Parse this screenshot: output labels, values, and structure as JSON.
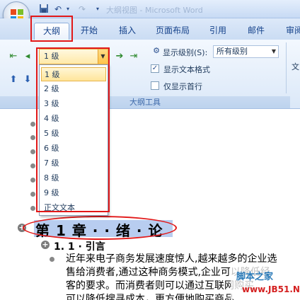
{
  "titlebar": {
    "title": "大纲视图 - Microsoft Word"
  },
  "quick_access": {
    "save_icon": "save-icon",
    "undo_icon": "undo-icon",
    "redo_icon": "redo-icon"
  },
  "tabs": [
    {
      "label": "大纲",
      "active": true
    },
    {
      "label": "开始"
    },
    {
      "label": "插入"
    },
    {
      "label": "页面布局"
    },
    {
      "label": "引用"
    },
    {
      "label": "邮件"
    },
    {
      "label": "审阅"
    }
  ],
  "ribbon": {
    "level_combo_value": "1 级",
    "show_level_label": "显示级别(S):",
    "show_level_value": "所有级别",
    "show_text_format_label": "显示文本格式",
    "show_text_format_checked": true,
    "show_first_line_label": "仅显示首行",
    "show_first_line_checked": false,
    "group_label": "大纲工具",
    "right_cut_text": "文"
  },
  "dropdown": {
    "items": [
      "1 级",
      "2 级",
      "3 级",
      "4 级",
      "5 级",
      "6 级",
      "7 级",
      "8 级",
      "9 级",
      "正文文本"
    ],
    "selected_index": 0
  },
  "document": {
    "chapter_title": "第 1 章 · · 绪 · 论",
    "subheading": "1. 1 · 引言",
    "body_lines": [
      "近年来电子商务发展速度惊人,越来越多的企业选",
      "售给消费者,通过这种商务模式,企业可以降低经",
      "客的要求。而消费者则可以通过互联网购买",
      "可以降低搜寻成本，更方便地购买商品"
    ]
  },
  "watermark": {
    "line1": "脚本之家",
    "line2": "www.JB51.Net"
  }
}
